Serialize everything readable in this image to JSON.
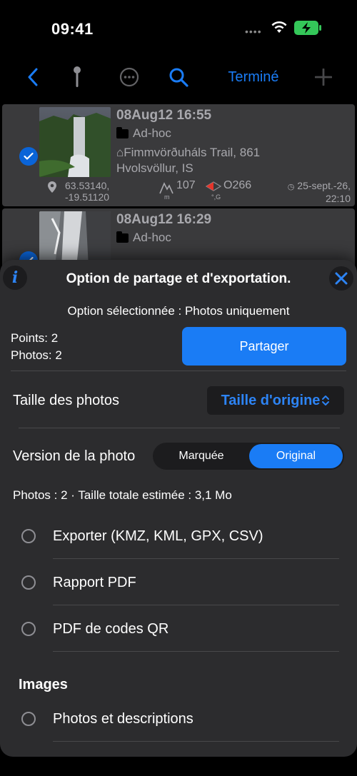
{
  "status": {
    "time": "09:41"
  },
  "toolbar": {
    "done_label": "Terminé"
  },
  "rows": [
    {
      "title": "08Aug12 16:55",
      "folder": "Ad-hoc",
      "addr_line1": "⌂Fimmvörðuháls Trail, 861",
      "addr_line2": "Hvolsvöllur, IS",
      "coord1": "63.53140,",
      "coord2": "-19.51120",
      "altitude": "107",
      "altitude_unit": "m",
      "heading": "O266",
      "heading_unit": "°,G",
      "date1": "25-sept.-26,",
      "date2": "22:10"
    },
    {
      "title": "08Aug12 16:29",
      "folder": "Ad-hoc"
    }
  ],
  "sheet": {
    "title": "Option de partage et d'exportation.",
    "selected_option": "Option sélectionnée : Photos uniquement",
    "points": "Points: 2",
    "photos": "Photos: 2",
    "share_label": "Partager",
    "size_label": "Taille des photos",
    "size_value": "Taille d'origine",
    "version_label": "Version de la photo",
    "version_options": [
      "Marquée",
      "Original"
    ],
    "version_selected": "Original",
    "estimate": "Photos : 2 · Taille totale estimée : 3,1 Mo",
    "options": [
      "Exporter (KMZ, KML, GPX, CSV)",
      "Rapport PDF",
      "PDF de codes QR"
    ],
    "section_images": "Images",
    "image_options": [
      "Photos et descriptions"
    ]
  },
  "colors": {
    "accent": "#1a7cf5",
    "sheet_bg": "#2c2c2e",
    "row_bg": "#3a3a3c",
    "battery": "#34c759"
  }
}
